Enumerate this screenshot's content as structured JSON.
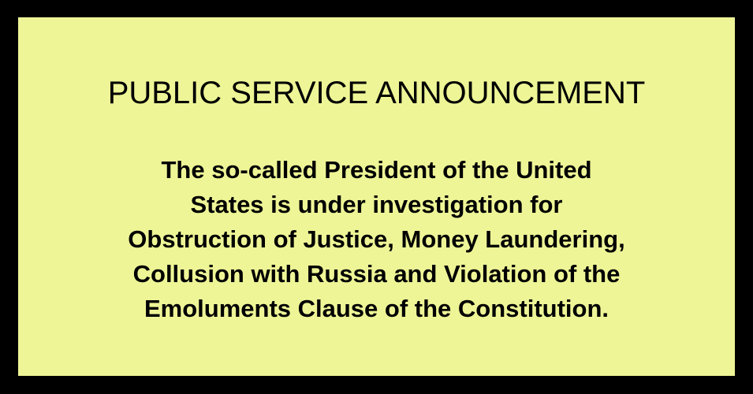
{
  "announcement": {
    "title": "PUBLIC SERVICE ANNOUNCEMENT",
    "lines": [
      "The so-called President of the United",
      "States is under investigation for",
      "Obstruction of Justice, Money Laundering,",
      "Collusion with Russia and Violation of the",
      "Emoluments Clause of the Constitution."
    ]
  },
  "colors": {
    "background": "#000000",
    "panel": "#eef596",
    "text": "#000000"
  }
}
